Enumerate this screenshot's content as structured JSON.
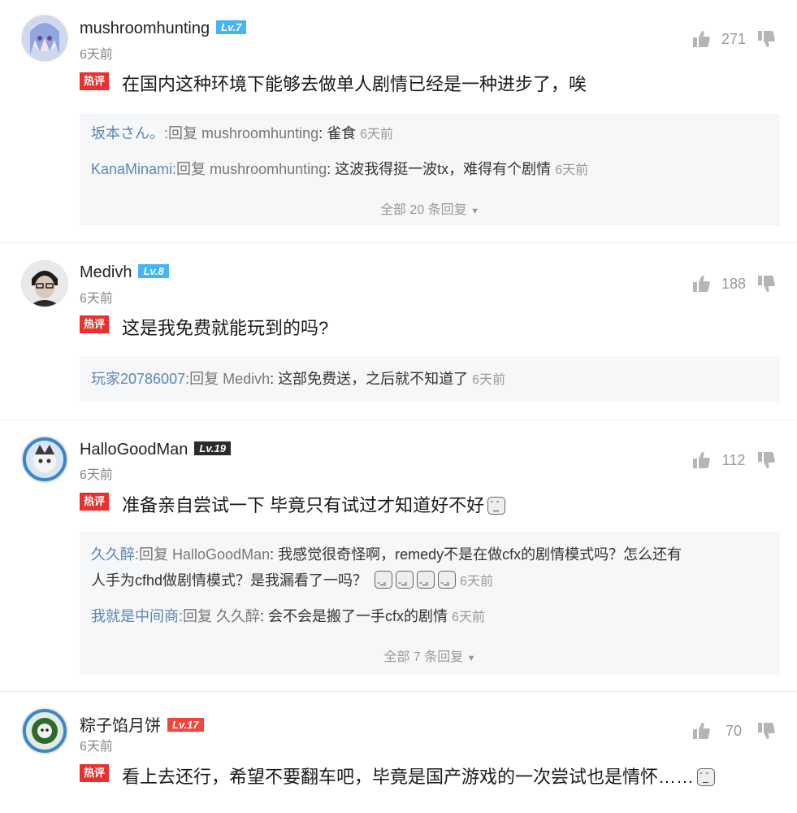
{
  "comments": [
    {
      "username": "mushroomhunting",
      "level": "Lv.7",
      "time": "6天前",
      "likes": "271",
      "badge": "热评",
      "text": "在国内这种环境下能够去做单人剧情已经是一种进步了，唉",
      "replies": [
        {
          "user": "坂本さん。",
          "sep": ":回复 ",
          "to": "mushroomhunting",
          "content": ": 雀食",
          "time": "6天前"
        },
        {
          "user": "KanaMinami",
          "sep": ":回复 ",
          "to": "mushroomhunting",
          "content": ": 这波我得挺一波tx，难得有个剧情",
          "time": "6天前"
        }
      ],
      "more": "全部 20 条回复"
    },
    {
      "username": "Medivh",
      "level": "Lv.8",
      "time": "6天前",
      "likes": "188",
      "badge": "热评",
      "text": "这是我免费就能玩到的吗?",
      "replies": [
        {
          "user": "玩家20786007",
          "sep": ":回复 ",
          "to": "Medivh",
          "content": ": 这部免费送，之后就不知道了",
          "time": "6天前"
        }
      ]
    },
    {
      "username": "HalloGoodMan",
      "level": "Lv.19",
      "time": "6天前",
      "likes": "112",
      "badge": "热评",
      "text": "准备亲自尝试一下 毕竟只有试过才知道好不好",
      "replies": [
        {
          "user": "久久醉",
          "sep": ":回复 ",
          "to": "HalloGoodMan",
          "content": ": 我感觉很奇怪啊，remedy不是在做cfx的剧情模式吗？怎么还有",
          "content2": "人手为cfhd做剧情模式？是我漏看了一吗？",
          "time": "6天前"
        },
        {
          "user": "我就是中间商",
          "sep": ":回复 ",
          "to": "久久醉",
          "content": ": 会不会是搬了一手cfx的剧情",
          "time": "6天前"
        }
      ],
      "more": "全部 7 条回复"
    },
    {
      "username": "粽子馅月饼",
      "level": "Lv.17",
      "time": "6天前",
      "likes": "70",
      "badge": "热评",
      "text": "看上去还行，希望不要翻车吧，毕竟是国产游戏的一次尝试也是情怀……"
    }
  ],
  "icons": {
    "like": "thumbs-up-icon",
    "dislike": "thumbs-down-icon",
    "expand": "chevron-down-icon",
    "emoji": "emoji-face-icon"
  },
  "colors": {
    "badge_red": "#e8302c",
    "reply_user_blue": "#5a87b5",
    "level_blue": "#45b4f5",
    "level_dark": "#2b2b2b",
    "level_red": "#f0463f"
  }
}
